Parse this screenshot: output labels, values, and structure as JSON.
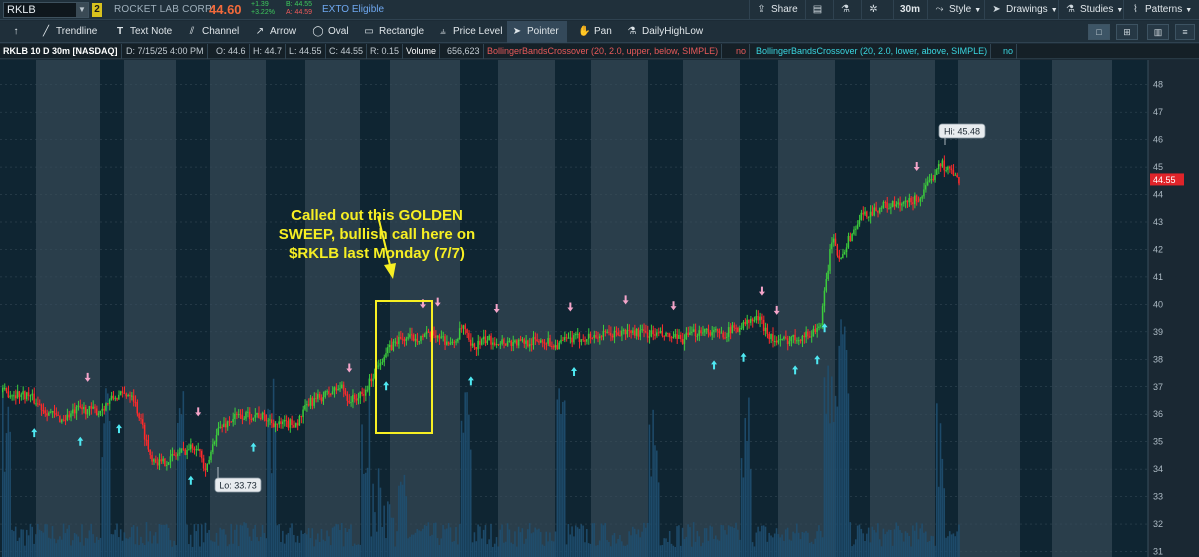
{
  "header": {
    "symbol": "RKLB",
    "link_badge": "2",
    "company": "ROCKET LAB CORP",
    "last_price": "44.60",
    "net_change": "+1.39",
    "pct_change": "+3.22%",
    "bid": "B: 44.55",
    "ask": "A: 44.59",
    "exto": "EXTO Eligible",
    "share": "Share",
    "timeframe": "30m",
    "style": "Style",
    "drawings": "Drawings",
    "studies": "Studies",
    "patterns": "Patterns"
  },
  "drawing_tools": {
    "trendline": "Trendline",
    "text_note": "Text Note",
    "channel": "Channel",
    "arrow": "Arrow",
    "oval": "Oval",
    "rectangle": "Rectangle",
    "price_level": "Price Level",
    "pointer": "Pointer",
    "pan": "Pan",
    "daily_high_low": "DailyHighLow"
  },
  "study_bar": {
    "title": "RKLB 10 D 30m [NASDAQ]",
    "date": "D: 7/15/25 4:00 PM",
    "open": "O: 44.6",
    "high": "H: 44.7",
    "low": "L: 44.55",
    "close": "C: 44.55",
    "range": "R: 0.15",
    "volume_label": "Volume",
    "volume_value": "656,623",
    "study1": "BollingerBandsCrossover (20, 2.0, upper, below, SIMPLE)",
    "study1_value": "no",
    "study2": "BollingerBandsCrossover (20, 2.0, lower, above, SIMPLE)",
    "study2_value": "no"
  },
  "annotation": {
    "line1": "Called out this GOLDEN",
    "line2": "SWEEP, bullish call here on",
    "line3": "$RKLB last Monday (7/7)"
  },
  "chart_data": {
    "type": "candlestick",
    "symbol": "RKLB",
    "interval": "30m",
    "y_ticks": [
      31,
      32,
      33,
      34,
      35,
      36,
      37,
      38,
      39,
      40,
      41,
      42,
      43,
      44,
      45,
      46,
      47,
      48
    ],
    "ylim": [
      30.8,
      48.9
    ],
    "hi_label": "Hi: 45.48",
    "lo_label": "Lo: 33.73",
    "current_price_label": "44.55",
    "anchors": [
      [
        0,
        36.8
      ],
      [
        14,
        36.7
      ],
      [
        22,
        36.2
      ],
      [
        32,
        35.8
      ],
      [
        42,
        36.2
      ],
      [
        52,
        36.1
      ],
      [
        60,
        36.6
      ],
      [
        70,
        36.8
      ],
      [
        76,
        35.5
      ],
      [
        80,
        34.5
      ],
      [
        86,
        34.2
      ],
      [
        96,
        34.6
      ],
      [
        106,
        34.9
      ],
      [
        110,
        33.8
      ],
      [
        116,
        35.4
      ],
      [
        126,
        35.9
      ],
      [
        138,
        36.0
      ],
      [
        150,
        35.6
      ],
      [
        160,
        35.7
      ],
      [
        166,
        36.4
      ],
      [
        178,
        36.8
      ],
      [
        184,
        37.0
      ],
      [
        188,
        36.5
      ],
      [
        196,
        36.7
      ],
      [
        204,
        37.9
      ],
      [
        214,
        38.7
      ],
      [
        224,
        38.8
      ],
      [
        236,
        38.9
      ],
      [
        244,
        38.5
      ],
      [
        250,
        39.2
      ],
      [
        254,
        38.4
      ],
      [
        262,
        38.7
      ],
      [
        280,
        38.6
      ],
      [
        294,
        38.7
      ],
      [
        300,
        38.5
      ],
      [
        306,
        38.7
      ],
      [
        316,
        38.8
      ],
      [
        330,
        38.9
      ],
      [
        340,
        39.0
      ],
      [
        356,
        38.9
      ],
      [
        368,
        38.7
      ],
      [
        380,
        39.1
      ],
      [
        390,
        38.9
      ],
      [
        400,
        39.2
      ],
      [
        410,
        39.5
      ],
      [
        416,
        38.9
      ],
      [
        420,
        38.6
      ],
      [
        430,
        38.8
      ],
      [
        438,
        38.9
      ],
      [
        444,
        39.3
      ],
      [
        450,
        42.4
      ],
      [
        454,
        41.7
      ],
      [
        466,
        43.2
      ],
      [
        478,
        43.6
      ],
      [
        488,
        43.6
      ],
      [
        498,
        43.9
      ],
      [
        504,
        44.5
      ],
      [
        508,
        45.2
      ],
      [
        514,
        44.9
      ],
      [
        518,
        44.55
      ]
    ],
    "signals_up": [
      17,
      42,
      63,
      102,
      136,
      208,
      254,
      310,
      386,
      402,
      430,
      442,
      446
    ],
    "signals_down": [
      46,
      106,
      188,
      228,
      236,
      268,
      308,
      338,
      364,
      412,
      420,
      496
    ]
  },
  "colors": {
    "bull": "#3ccc3c",
    "bear": "#ff2a2a",
    "session_dark": "#0f2532",
    "session_light": "#2a3e4b",
    "volume": "#1f4f70",
    "signal_up": "#4fe8f2",
    "signal_down": "#f4a4c9",
    "annotation": "#f7ef23",
    "price_tag": "#e0242a"
  }
}
